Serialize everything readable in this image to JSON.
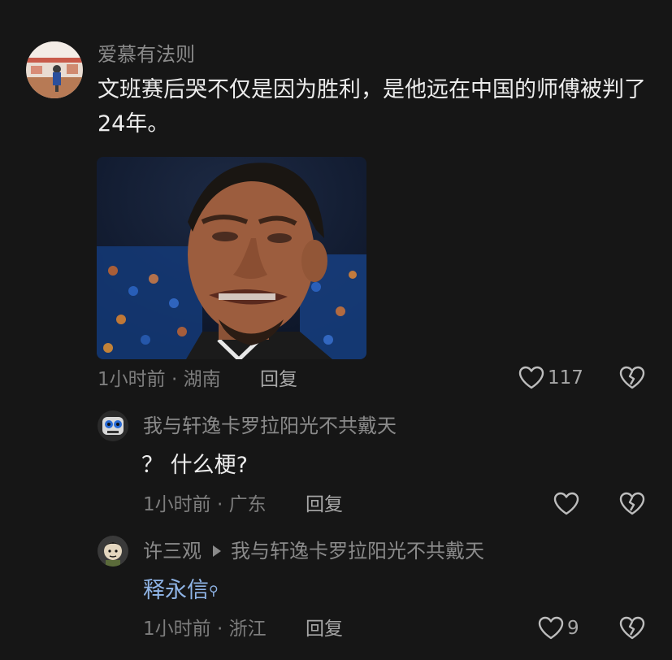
{
  "main_comment": {
    "username": "爱慕有法则",
    "text": "文班赛后哭不仅是因为胜利，是他远在中国的师傅被判了24年。",
    "time": "1小时前",
    "location": "湖南",
    "meta_separator": "·",
    "reply_label": "回复",
    "likes": "117",
    "avatar_icon": "avatar-photo",
    "image_icon": "crying-athlete-photo"
  },
  "replies": [
    {
      "username": "我与轩逸卡罗拉阳光不共戴天",
      "text": "？ 什么梗?",
      "time": "1小时前",
      "location": "广东",
      "meta_separator": "·",
      "reply_label": "回复",
      "likes": ""
    },
    {
      "username": "许三观",
      "reply_to": "我与轩逸卡罗拉阳光不共戴天",
      "text": "释永信",
      "time": "1小时前",
      "location": "浙江",
      "meta_separator": "·",
      "reply_label": "回复",
      "likes": "9"
    }
  ],
  "colors": {
    "background": "#161616",
    "username": "#8a8a8a",
    "text": "#ececec",
    "link": "#8fb4e6"
  }
}
